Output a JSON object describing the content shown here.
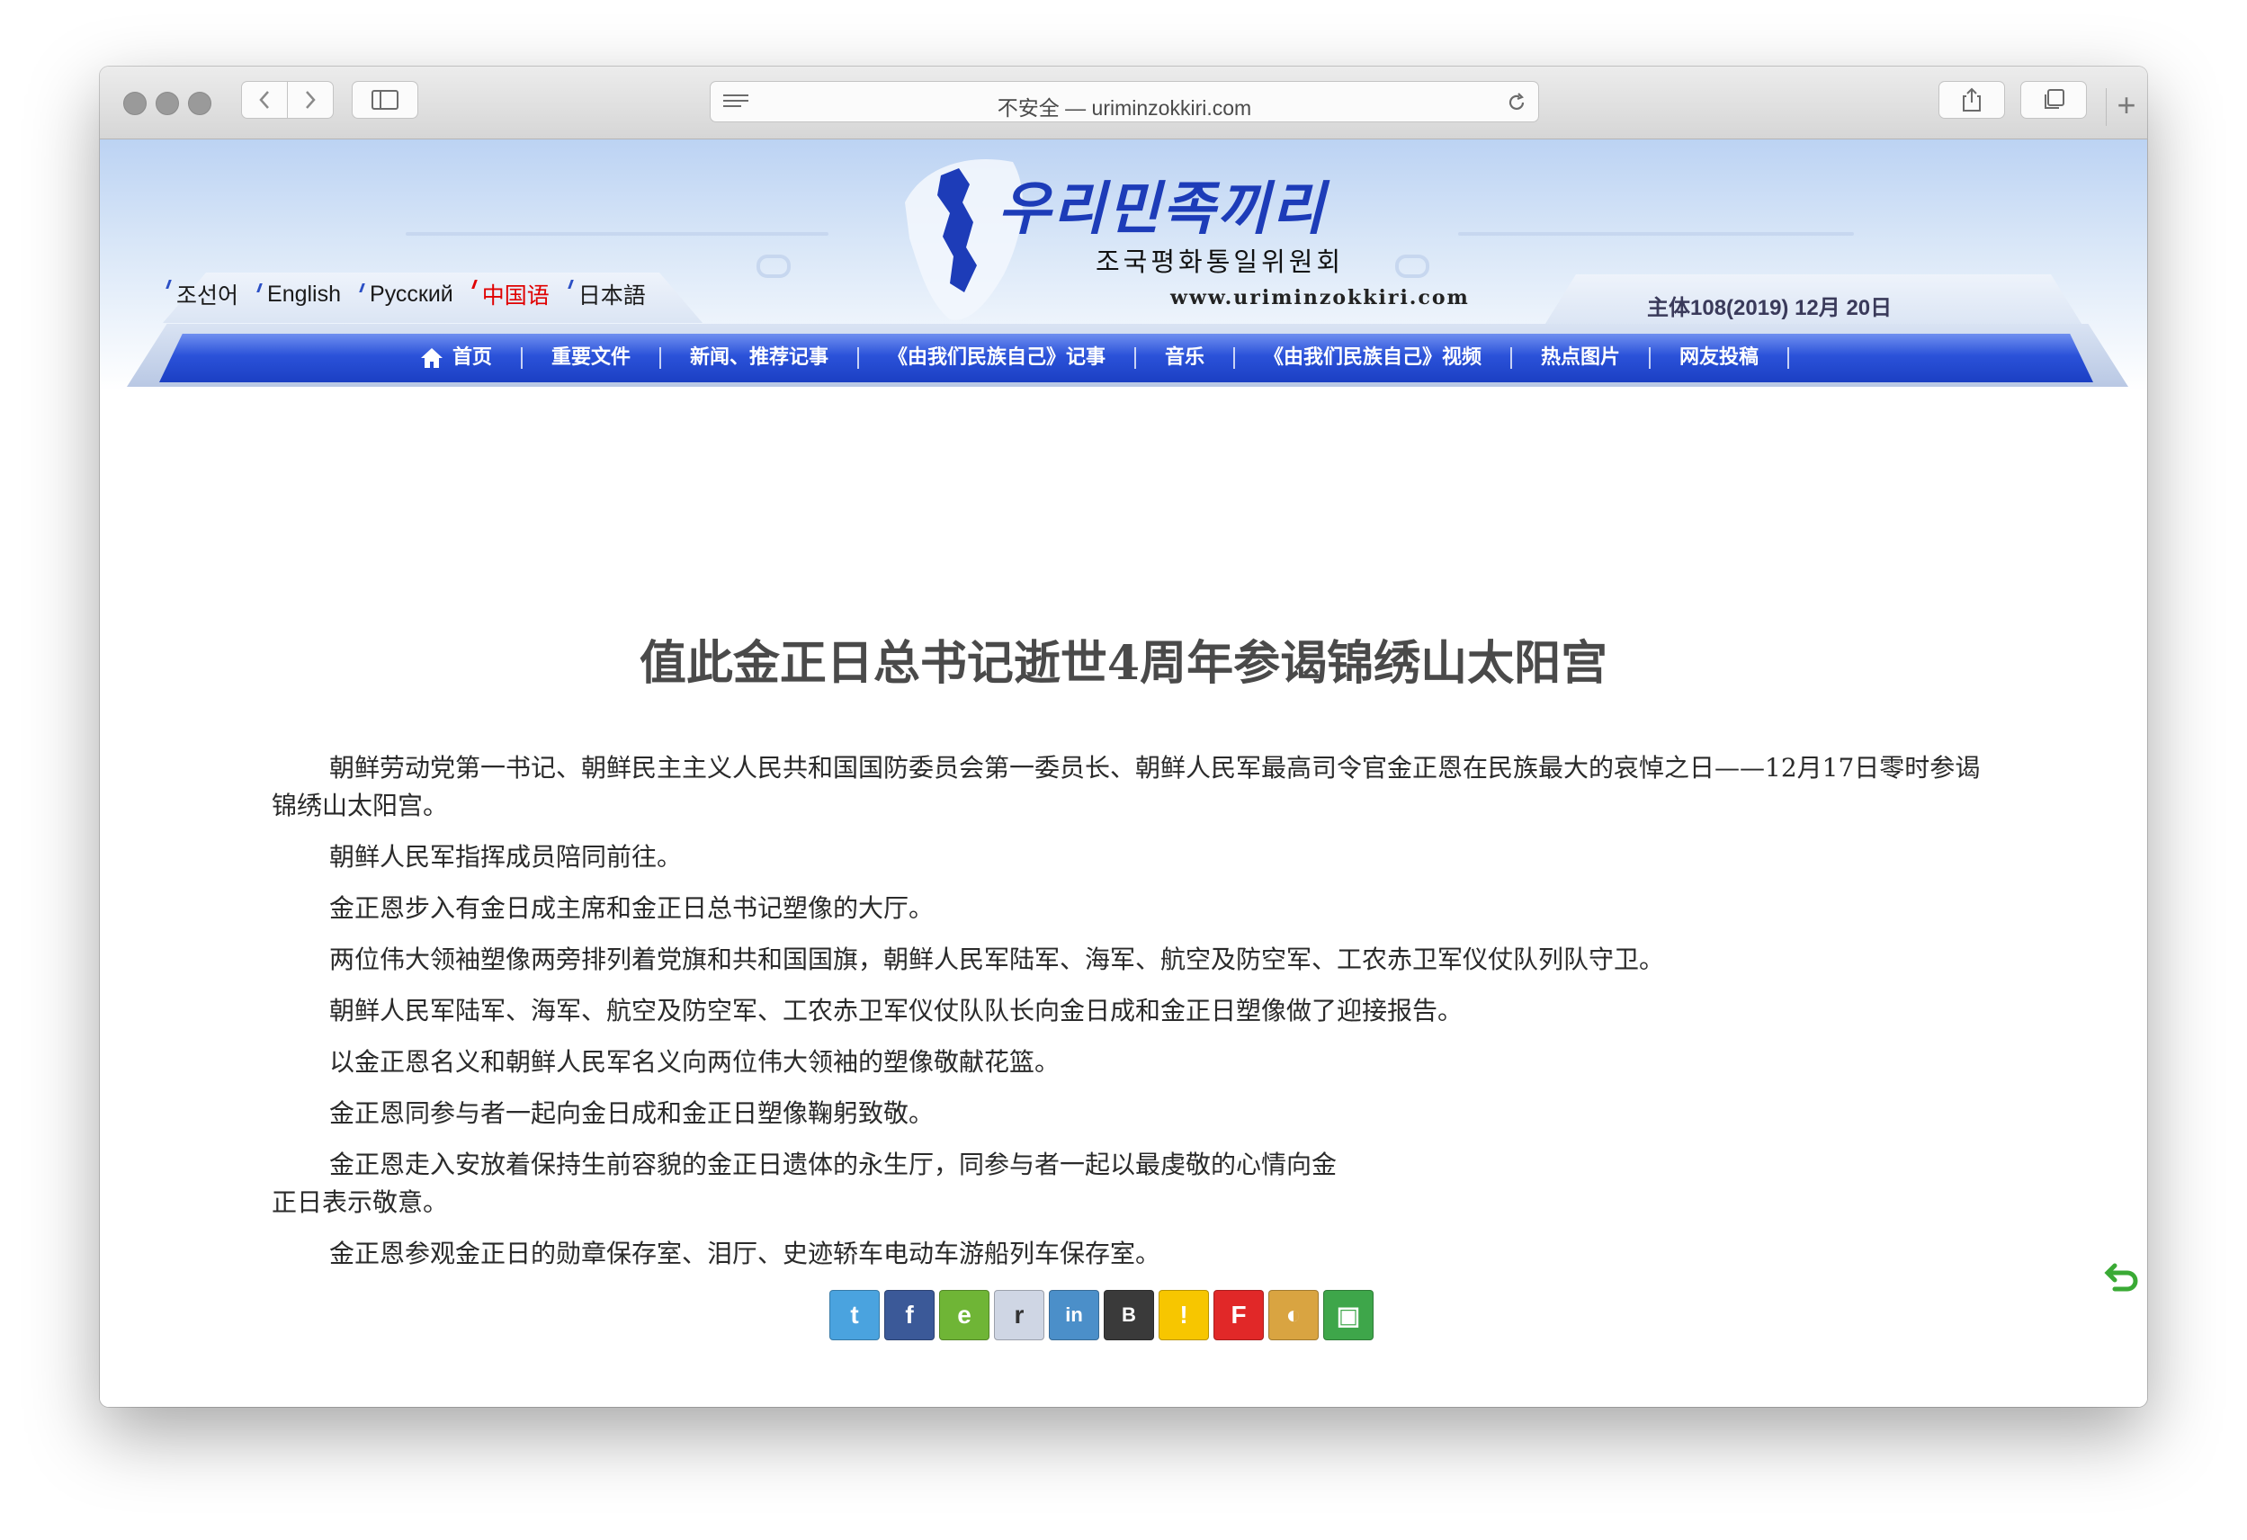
{
  "browser": {
    "address_text": "不安全 — uriminzokkiri.com",
    "new_tab_label": "+"
  },
  "site": {
    "logo_script": "우리민족끼리",
    "logo_subtitle": "조국평화통일위원회",
    "logo_url": "www.uriminzokkiri.com",
    "languages": [
      "조선어",
      "English",
      "Русский",
      "中国语",
      "日本語"
    ],
    "active_language": "中国语",
    "date": "主体108(2019) 12月 20日",
    "nav": [
      "首页",
      "重要文件",
      "新闻、推荐记事",
      "《由我们民族自己》记事",
      "音乐",
      "《由我们民族自己》视频",
      "热点图片",
      "网友投稿"
    ]
  },
  "article": {
    "title": "值此金正日总书记逝世4周年参谒锦绣山太阳宫",
    "paragraphs": [
      "朝鲜劳动党第一书记、朝鲜民主主义人民共和国国防委员会第一委员长、朝鲜人民军最高司令官金正恩在民族最大的哀悼之日——12月17日零时参谒锦绣山太阳宫。",
      "朝鲜人民军指挥成员陪同前往。",
      "金正恩步入有金日成主席和金正日总书记塑像的大厅。",
      "两位伟大领袖塑像两旁排列着党旗和共和国国旗，朝鲜人民军陆军、海军、航空及防空军、工农赤卫军仪仗队列队守卫。",
      "朝鲜人民军陆军、海军、航空及防空军、工农赤卫军仪仗队队长向金日成和金正日塑像做了迎接报告。",
      "以金正恩名义和朝鲜人民军名义向两位伟大领袖的塑像敬献花篮。",
      "金正恩同参与者一起向金日成和金正日塑像鞠躬致敬。",
      "金正恩走入安放着保持生前容貌的金正日遗体的永生厅，同参与者一起以最虔敬的心情向金正日表示敬意。",
      "金正恩参观金正日的勋章保存室、泪厅、史迹轿车电动车游船列车保存室。"
    ]
  },
  "share": [
    {
      "name": "twitter",
      "glyph": "t",
      "color": "#4aa3df"
    },
    {
      "name": "facebook",
      "glyph": "f",
      "color": "#3b5998"
    },
    {
      "name": "evernote",
      "glyph": "e",
      "color": "#6fb536"
    },
    {
      "name": "reddit",
      "glyph": "r",
      "color": "#cfd6e4"
    },
    {
      "name": "linkedin",
      "glyph": "in",
      "color": "#4b8fc9"
    },
    {
      "name": "band",
      "glyph": "B",
      "color": "#3a3a3a"
    },
    {
      "name": "kakaostory",
      "glyph": "!",
      "color": "#f7c600"
    },
    {
      "name": "flipboard",
      "glyph": "F",
      "color": "#e12828"
    },
    {
      "name": "colorful",
      "glyph": "◐",
      "color": "#d9a441"
    },
    {
      "name": "bookmark",
      "glyph": "▣",
      "color": "#3ea64a"
    }
  ]
}
